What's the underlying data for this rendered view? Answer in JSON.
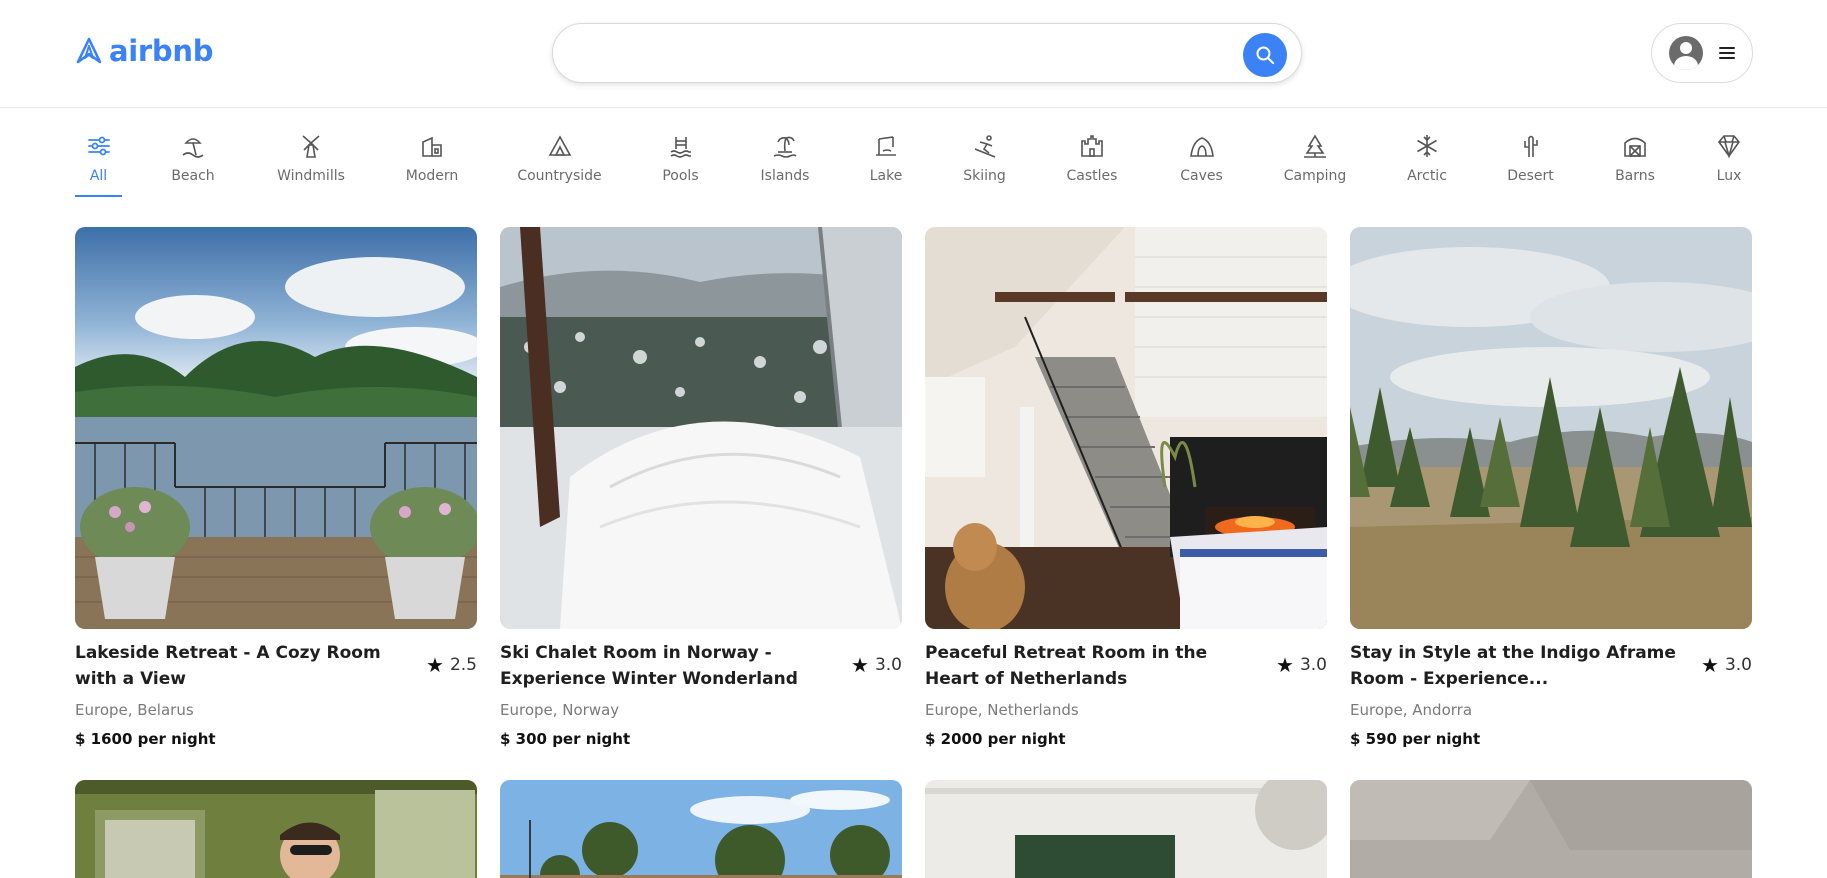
{
  "brand": {
    "name": "airbnb",
    "color": "#3b82f6"
  },
  "search": {
    "value": "",
    "placeholder": "",
    "button_icon": "search-icon"
  },
  "user_menu": {
    "avatar_icon": "user-avatar-icon",
    "menu_icon": "hamburger-icon"
  },
  "categories": [
    {
      "label": "All",
      "icon": "sliders-icon",
      "active": true
    },
    {
      "label": "Beach",
      "icon": "beach-icon"
    },
    {
      "label": "Windmills",
      "icon": "windmill-icon"
    },
    {
      "label": "Modern",
      "icon": "modern-house-icon"
    },
    {
      "label": "Countryside",
      "icon": "tent-icon"
    },
    {
      "label": "Pools",
      "icon": "pool-icon"
    },
    {
      "label": "Islands",
      "icon": "island-icon"
    },
    {
      "label": "Lake",
      "icon": "lake-icon"
    },
    {
      "label": "Skiing",
      "icon": "skiing-icon"
    },
    {
      "label": "Castles",
      "icon": "castle-icon"
    },
    {
      "label": "Caves",
      "icon": "cave-icon"
    },
    {
      "label": "Camping",
      "icon": "camping-icon"
    },
    {
      "label": "Arctic",
      "icon": "snowflake-icon"
    },
    {
      "label": "Desert",
      "icon": "cactus-icon"
    },
    {
      "label": "Barns",
      "icon": "barn-icon"
    },
    {
      "label": "Lux",
      "icon": "diamond-icon"
    }
  ],
  "listings": [
    {
      "title": "Lakeside Retreat - A Cozy Room with a View",
      "rating": "2.5",
      "location": "Europe, Belarus",
      "price": "$ 1600 per night"
    },
    {
      "title": "Ski Chalet Room in Norway - Experience Winter Wonderland",
      "rating": "3.0",
      "location": "Europe, Norway",
      "price": "$ 300 per night"
    },
    {
      "title": "Peaceful Retreat Room in the Heart of Netherlands",
      "rating": "3.0",
      "location": "Europe, Netherlands",
      "price": "$ 2000 per night"
    },
    {
      "title": "Stay in Style at the Indigo Aframe Room - Experience...",
      "rating": "3.0",
      "location": "Europe, Andorra",
      "price": "$ 590 per night"
    }
  ]
}
